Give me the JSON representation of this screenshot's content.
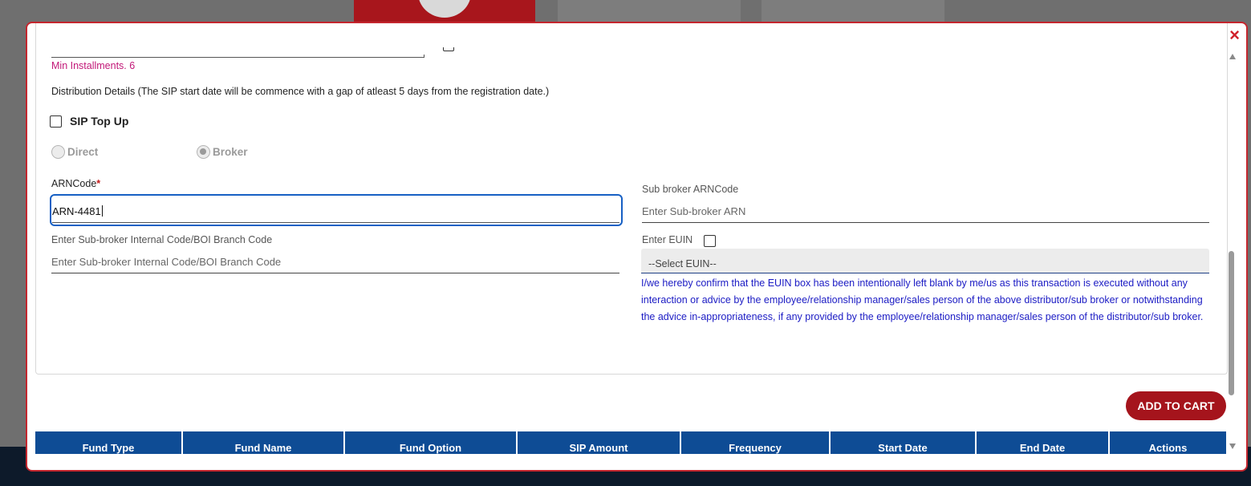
{
  "modal": {
    "close_icon": "×"
  },
  "form": {
    "min_installments": "Min Installments. 6",
    "distribution_details": "Distribution Details (The SIP start date will be commence with a gap of atleast 5 days from the registration date.)",
    "sip_top_up_label": "SIP Top Up",
    "sip_top_up_checked": false,
    "mode_options": [
      {
        "label": "Direct",
        "checked": false
      },
      {
        "label": "Broker",
        "checked": true
      }
    ],
    "arn_code_label": "ARNCode",
    "arn_code_required_mark": "*",
    "arn_code_value": "ARN-4481",
    "sub_broker_arn_label": "Sub broker ARNCode",
    "sub_broker_arn_placeholder": "Enter Sub-broker ARN",
    "sub_broker_internal_label": "Enter Sub-broker Internal Code/BOI Branch Code",
    "sub_broker_internal_placeholder": "Enter Sub-broker Internal Code/BOI Branch Code",
    "euin_label": "Enter EUIN",
    "euin_checked": false,
    "euin_select_value": "--Select EUIN--",
    "declaration": "I/we hereby confirm that the EUIN box has been intentionally left blank by me/us as this transaction is executed without any interaction or advice by the employee/relationship manager/sales person of the above distributor/sub broker or notwithstanding the advice in-appropriateness, if any provided by the employee/relationship manager/sales person of the distributor/sub broker."
  },
  "actions": {
    "add_to_cart": "ADD TO CART"
  },
  "table": {
    "columns": [
      "Fund Type",
      "Fund Name",
      "Fund Option",
      "SIP Amount",
      "Frequency",
      "Start Date",
      "End Date",
      "Actions"
    ]
  },
  "colors": {
    "accent_red": "#a5141c",
    "header_blue": "#0e4c95",
    "declaration_blue": "#1b1bc4",
    "hint_magenta": "#c21878",
    "focus_blue": "#1760c4"
  }
}
